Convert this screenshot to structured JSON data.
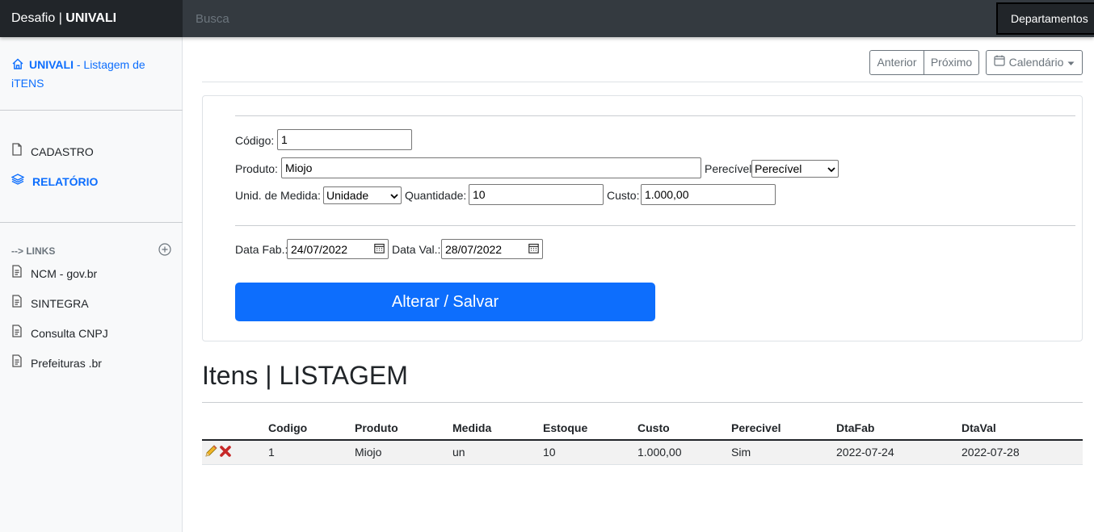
{
  "navbar": {
    "brand_prefix": "Desafio | ",
    "brand_bold": "UNIVALI",
    "search_placeholder": "Busca",
    "dept_button": "Departamentos"
  },
  "sidebar": {
    "header_bold": "UNIVALI",
    "header_rest": " - Listagem de iTENS",
    "items": [
      {
        "label": "CADASTRO",
        "icon": "file-icon"
      },
      {
        "label": "RELATÓRIO",
        "icon": "layers-icon"
      }
    ],
    "links_heading": "--> LINKS",
    "links": [
      {
        "label": "NCM - gov.br"
      },
      {
        "label": "SINTEGRA"
      },
      {
        "label": "Consulta CNPJ"
      },
      {
        "label": "Prefeituras .br"
      }
    ]
  },
  "toolbar": {
    "prev": "Anterior",
    "next": "Próximo",
    "calendar": "Calendário"
  },
  "form": {
    "codigo_label": "Código:",
    "codigo_value": "1",
    "produto_label": "Produto:",
    "produto_value": "Miojo",
    "perecivel_label": "Perecível",
    "perecivel_value": "Perecível",
    "medida_label": "Unid. de Medida:",
    "medida_value": "Unidade",
    "quantidade_label": "Quantidade:",
    "quantidade_value": "10",
    "custo_label": "Custo:",
    "custo_value": "1.000,00",
    "datafab_label": "Data Fab.:",
    "datafab_value": "24/07/2022",
    "dataval_label": "Data Val.:",
    "dataval_value": "28/07/2022",
    "save_button": "Alterar / Salvar"
  },
  "listing": {
    "title": "Itens | LISTAGEM",
    "headers": [
      "Codigo",
      "Produto",
      "Medida",
      "Estoque",
      "Custo",
      "Perecivel",
      "DtaFab",
      "DtaVal"
    ],
    "rows": [
      [
        "1",
        "Miojo",
        "un",
        "10",
        "1.000,00",
        "Sim",
        "2022-07-24",
        "2022-07-28"
      ]
    ]
  },
  "colors": {
    "accent": "#0d6efd",
    "navbar": "#343a40",
    "brand_bg": "#212529",
    "sidebar_bg": "#f8f9fa"
  }
}
